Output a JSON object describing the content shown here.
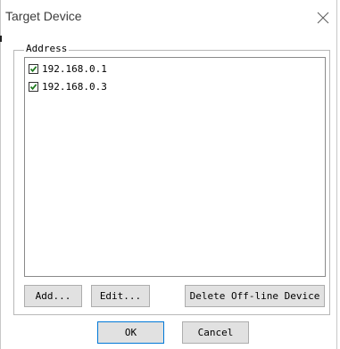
{
  "dialog": {
    "title": "Target Device",
    "close_icon": "close-icon"
  },
  "address_group": {
    "label": "Address",
    "items": [
      {
        "label": "192.168.0.1",
        "checked": true
      },
      {
        "label": "192.168.0.3",
        "checked": true
      }
    ]
  },
  "buttons": {
    "add": "Add...",
    "edit": "Edit...",
    "delete_offline": "Delete Off-line Device",
    "ok": "OK",
    "cancel": "Cancel"
  },
  "colors": {
    "checkmark": "#1f7a1f",
    "default_button_border": "#0078d7"
  }
}
